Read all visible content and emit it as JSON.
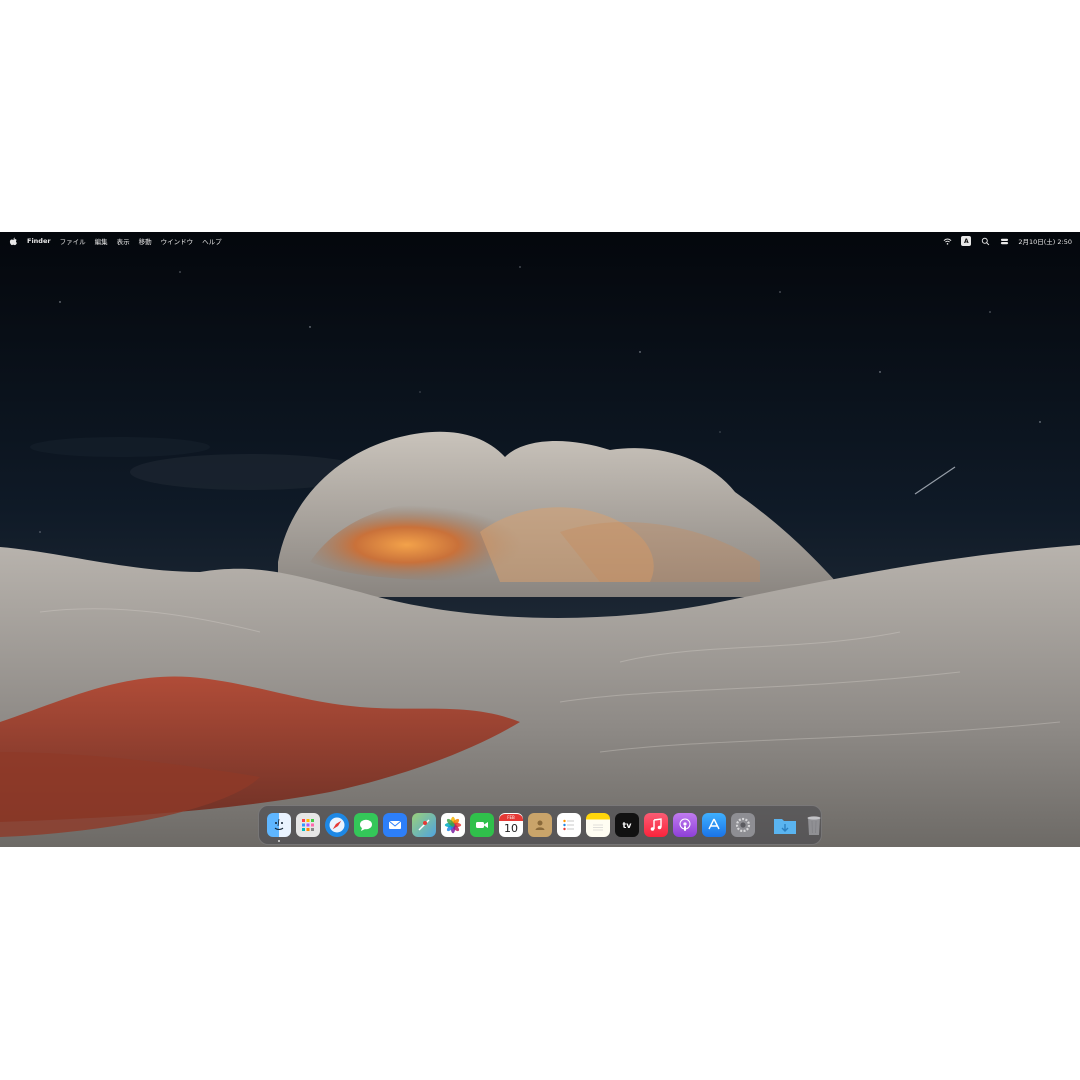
{
  "menubar": {
    "apple_icon": "apple-icon",
    "app_name": "Finder",
    "menus": [
      "ファイル",
      "編集",
      "表示",
      "移動",
      "ウインドウ",
      "ヘルプ"
    ],
    "status_icons": [
      "wifi-icon",
      "input-source-icon",
      "search-icon",
      "control-center-icon"
    ],
    "input_source_label": "A",
    "clock": "2月10日(土) 2:50"
  },
  "dock": {
    "apps": [
      {
        "name": "Finder",
        "icon": "finder-icon",
        "color": "#2f8cf0"
      },
      {
        "name": "Launchpad",
        "icon": "launchpad-icon",
        "color": "#d9d9d9"
      },
      {
        "name": "Safari",
        "icon": "safari-icon",
        "color": "#1e88e5"
      },
      {
        "name": "Messages",
        "icon": "messages-icon",
        "color": "#34c759"
      },
      {
        "name": "Mail",
        "icon": "mail-icon",
        "color": "#2d7ff9"
      },
      {
        "name": "Maps",
        "icon": "maps-icon",
        "color": "#6cc070"
      },
      {
        "name": "Photos",
        "icon": "photos-icon",
        "color": "#ffffff"
      },
      {
        "name": "FaceTime",
        "icon": "facetime-icon",
        "color": "#30c04b"
      },
      {
        "name": "Calendar",
        "icon": "calendar-icon",
        "color": "#ffffff"
      },
      {
        "name": "Contacts",
        "icon": "contacts-icon",
        "color": "#c9a46a"
      },
      {
        "name": "Reminders",
        "icon": "reminders-icon",
        "color": "#ffffff"
      },
      {
        "name": "Notes",
        "icon": "notes-icon",
        "color": "#ffd60a"
      },
      {
        "name": "TV",
        "icon": "tv-icon",
        "color": "#111111"
      },
      {
        "name": "Music",
        "icon": "music-icon",
        "color": "#fa2d48"
      },
      {
        "name": "Podcasts",
        "icon": "podcasts-icon",
        "color": "#9b4fe0"
      },
      {
        "name": "App Store",
        "icon": "app-store-icon",
        "color": "#1e90ff"
      },
      {
        "name": "System Preferences",
        "icon": "system-preferences-icon",
        "color": "#8e8e93"
      }
    ],
    "calendar": {
      "month": "FEB",
      "day": "10"
    },
    "tv_label": "tv",
    "folders": [
      {
        "name": "Downloads",
        "icon": "downloads-folder-icon",
        "color": "#5ab4f0"
      },
      {
        "name": "Trash",
        "icon": "trash-icon",
        "color": "#9a9a9f"
      }
    ]
  }
}
